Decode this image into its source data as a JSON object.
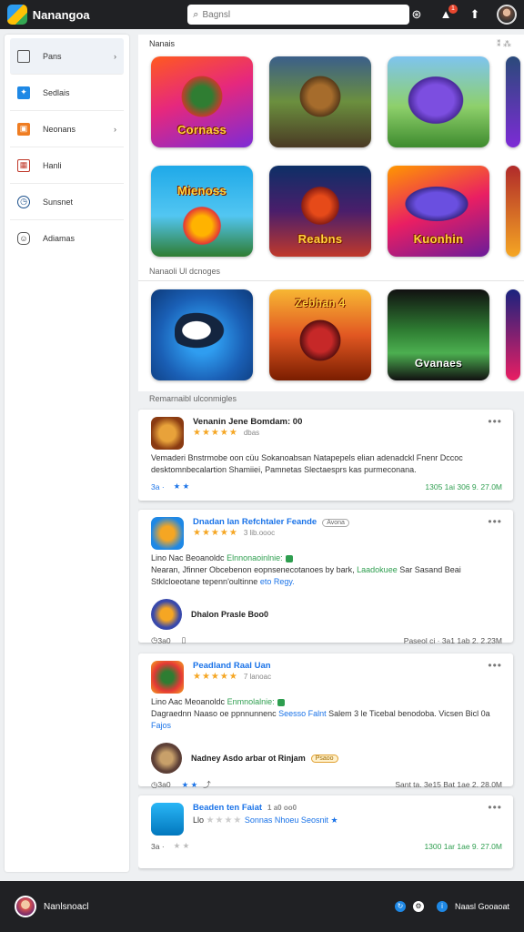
{
  "app": {
    "title": "Nanangoa"
  },
  "search": {
    "placeholder": "Bagnsl"
  },
  "notifications": {
    "count": "1"
  },
  "sidebar": {
    "items": [
      {
        "label": "Pans",
        "icon": "home-icon",
        "chevron": "›"
      },
      {
        "label": "Sedlais",
        "icon": "blue-app-icon"
      },
      {
        "label": "Neonans",
        "icon": "orange-app-icon",
        "chevron": "›"
      },
      {
        "label": "Hanli",
        "icon": "photos-icon"
      },
      {
        "label": "Sunsnet",
        "icon": "compass-icon"
      },
      {
        "label": "Adiamas",
        "icon": "chat-icon"
      }
    ]
  },
  "section1": {
    "title": "Nanais",
    "more": "⁑ ⁂",
    "row1": [
      "Cornass",
      "",
      "",
      ""
    ],
    "row2": [
      "Mienoss",
      "Reabns",
      "Kuonhin",
      ""
    ]
  },
  "section2": {
    "title": "Nanaoli Ul dcnoges",
    "row": [
      "",
      "Zebhan 4",
      "Gvanaes",
      ""
    ]
  },
  "section3": {
    "title": "Remarnaibl ulconmigles"
  },
  "cards": [
    {
      "title": "Venanin Jene Bomdam: 00",
      "rating_note": "dbas",
      "text": "Vemaderi  Bnstrmobe oon cüu Sokanoabsan  Natapepels elian adenadckl Fnenr Dccoc desktomnbecalartion Shamiiei, Pamnetas Slectaesprs kas purmeconana.",
      "meta_left": "3a  ·",
      "meta_right": "1305  1ai  306  9. 27.0M"
    },
    {
      "title": "Dnadan Ian Refchtaler Feande",
      "chip": "Avona",
      "rating_note": "3 lib.oooc",
      "lead": "Lino  Nac Beoanoldc  ",
      "lead_link": "Elnnonaoinlnie:",
      "text": "Nearan, Jfinner Obcebenon eopnsenecotanoes by bark, ",
      "text_link": "Laadokuee",
      "text_tail": " Sar Sasand  Beai Stklcloeotane tepenn'oultinne ",
      "text_link2": "eto Regy.",
      "author": "Dhalon Prasle Boo0",
      "meta_left": "3a0",
      "meta_right": "Paseol ci   ·   3a1   1ab   2. 2.23M"
    },
    {
      "title": "Peadland Raal Uan",
      "rating_note": "7 lanoac",
      "lead": "Lino  Aac Meoanoldc  ",
      "lead_link": "Enmnolalnie:",
      "text": "Dagraednn Naaso oe  ppnnunnenc  ",
      "text_link": "Seesso Falnt",
      "text_tail": " Salem 3 le  Ticebal benodoba.  Vicsen Bicl  0a  ",
      "text_link2": "Fajos",
      "author": "Nadney Asdo arbar ot Rinjam",
      "chip": "Psaoo",
      "meta_left": "3a0",
      "meta_right": "Sant  ta.  3e15  Bat  1ae  2. 28.0M"
    },
    {
      "title": "Beaden  ten Faiat",
      "rating_note": "1 a0 oo0",
      "lead": "Llo ",
      "lead_link": "Sonnas Nhoeu Seosnit",
      "meta_left": "3a  ·",
      "meta_right": "1300  1ar  1ae  9. 27.0M"
    }
  ],
  "bottom": {
    "user": "Nanlsnoacl",
    "right_label": "Naasl Gooaoat"
  }
}
